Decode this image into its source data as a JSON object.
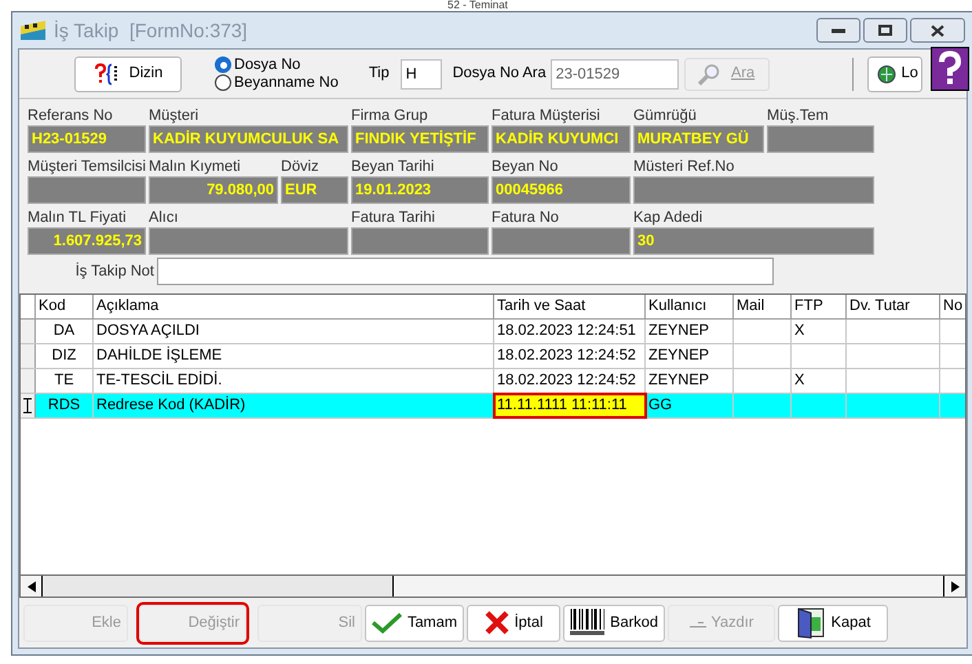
{
  "background_text": "52 - Teminat",
  "window": {
    "title": "İş Takip  [FormNo:373]"
  },
  "toolbar": {
    "index_button": "Dizin",
    "search_mode": [
      {
        "label": "Dosya No",
        "selected": true
      },
      {
        "label": "Beyanname No",
        "selected": false
      }
    ],
    "tip_label": "Tip",
    "tip_value": "H",
    "file_search_label": "Dosya No Ara",
    "file_search_value": "23-01529",
    "search_button": {
      "label": "Ara",
      "disabled": true
    },
    "lock_button": "Lo"
  },
  "fields": [
    {
      "label": "Referans No",
      "value": "H23-01529"
    },
    {
      "label": "Müşteri",
      "value": "KADİR KUYUMCULUK SA"
    },
    {
      "label": "Firma Grup",
      "value": "FINDIK YETİŞTİF"
    },
    {
      "label": "Fatura Müşterisi",
      "value": "KADİR KUYUMCI"
    },
    {
      "label": "Gümrüğü",
      "value": "MURATBEY GÜ"
    },
    {
      "label": "Müş.Tem"
    },
    {
      "label": "Müşteri Temsilcisi"
    },
    {
      "label": "Malın Kıymeti",
      "value": "79.080,00"
    },
    {
      "label": "Döviz",
      "value": "EUR"
    },
    {
      "label": "Beyan Tarihi",
      "value": "19.01.2023"
    },
    {
      "label": "Beyan No",
      "value": "00045966"
    },
    {
      "label": "Müsteri Ref.No"
    },
    {
      "label": "Malın TL Fiyati",
      "value": "1.607.925,73"
    },
    {
      "label": "Alıcı"
    },
    {
      "label": "Fatura Tarihi"
    },
    {
      "label": "Fatura No"
    },
    {
      "label": "Kap Adedi",
      "value": "30"
    }
  ],
  "note": {
    "label": "İş Takip Not"
  },
  "table": {
    "columns": [
      "Kod",
      "Açıklama",
      "Tarih ve Saat",
      "Kullanıcı",
      "Mail",
      "FTP",
      "Dv. Tutar",
      "No"
    ],
    "rows": [
      {
        "cells": [
          "DA",
          "DOSYA AÇILDI",
          "18.02.2023 12:24:51",
          "ZEYNEP",
          "",
          "X",
          ""
        ],
        "selected": false,
        "highlighted": false
      },
      {
        "cells": [
          "DIZ",
          "DAHİLDE İŞLEME",
          "18.02.2023 12:24:52",
          "ZEYNEP",
          "",
          "",
          ""
        ],
        "selected": false,
        "highlighted": false
      },
      {
        "cells": [
          "TE",
          "TE-TESCİL EDİDİ.",
          "18.02.2023 12:24:52",
          "ZEYNEP",
          "",
          "X",
          ""
        ],
        "selected": false,
        "highlighted": false
      },
      {
        "cells": [
          "RDS",
          "Redrese Kod (KADİR)",
          "11.11.1111 11:11:11",
          "GG",
          "",
          "",
          ""
        ],
        "selected": true,
        "highlighted": true
      }
    ]
  },
  "buttons": [
    {
      "label": "Ekle",
      "kind": "plain",
      "disabled": true,
      "highlighted": false
    },
    {
      "label": "Değiştir",
      "kind": "plain",
      "disabled": true,
      "highlighted": true
    },
    {
      "label": "Sil",
      "kind": "plain",
      "disabled": true,
      "highlighted": false
    },
    {
      "label": "Tamam",
      "kind": "check",
      "disabled": false,
      "highlighted": false
    },
    {
      "label": "İptal",
      "kind": "cross",
      "disabled": false,
      "highlighted": false
    },
    {
      "label": "Barkod",
      "kind": "barcode",
      "disabled": false,
      "highlighted": false
    },
    {
      "label": "Yazdır",
      "kind": "print",
      "disabled": true,
      "highlighted": false
    },
    {
      "label": "Kapat",
      "kind": "door",
      "disabled": false,
      "highlighted": false
    }
  ]
}
